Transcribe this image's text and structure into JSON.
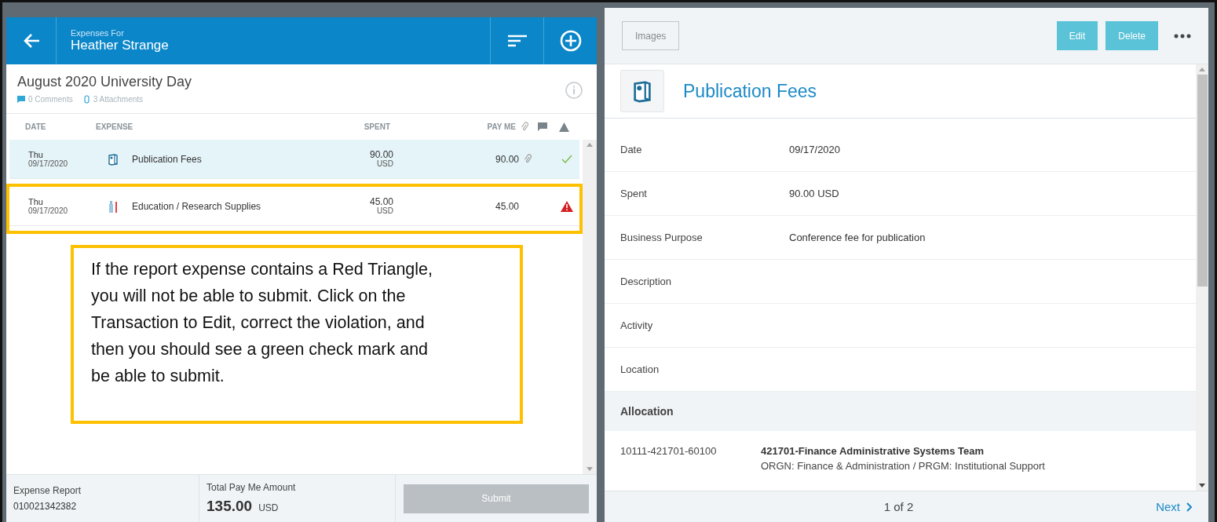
{
  "header": {
    "subtitle": "Expenses For",
    "title": "Heather Strange"
  },
  "report": {
    "title": "August 2020 University Day",
    "comments": "0 Comments",
    "attachments": "3 Attachments"
  },
  "columns": {
    "date": "DATE",
    "expense": "EXPENSE",
    "spent": "SPENT",
    "pay_me": "PAY ME"
  },
  "rows": [
    {
      "day": "Thu",
      "date": "09/17/2020",
      "kind": "book",
      "name": "Publication Fees",
      "spent": "90.00",
      "currency": "USD",
      "pay_me": "90.00",
      "attachment": true,
      "violation": false,
      "selected": true,
      "highlighted": false
    },
    {
      "day": "Thu",
      "date": "09/17/2020",
      "kind": "bottle",
      "name": "Education / Research Supplies",
      "spent": "45.00",
      "currency": "USD",
      "pay_me": "45.00",
      "attachment": false,
      "violation": true,
      "selected": false,
      "highlighted": true
    }
  ],
  "callout": "If the report expense contains a Red Triangle, you will not be able to submit. Click on the Transaction to Edit, correct the violation, and then you should see a green check mark and be able to submit.",
  "footer": {
    "report_label": "Expense Report",
    "report_number": "010021342382",
    "total_label": "Total Pay Me Amount",
    "total": "135.00",
    "currency": "USD",
    "submit": {
      "label": "Submit",
      "disabled": true
    }
  },
  "detail": {
    "images": "Images",
    "edit": "Edit",
    "delete": "Delete",
    "title": "Publication Fees",
    "fields": [
      {
        "label": "Date",
        "value": "09/17/2020"
      },
      {
        "label": "Spent",
        "value": "90.00 USD"
      },
      {
        "label": "Business Purpose",
        "value": "Conference fee for publication"
      },
      {
        "label": "Description"
      },
      {
        "label": "Activity"
      },
      {
        "label": "Location"
      }
    ],
    "allocation_header": "Allocation",
    "allocation": {
      "code": "10111-421701-60100",
      "name": "421701-Finance Administrative Systems Team",
      "detail": "ORGN: Finance & Administration / PRGM: Institutional Support"
    },
    "pager": "1 of 2",
    "next": "Next"
  }
}
